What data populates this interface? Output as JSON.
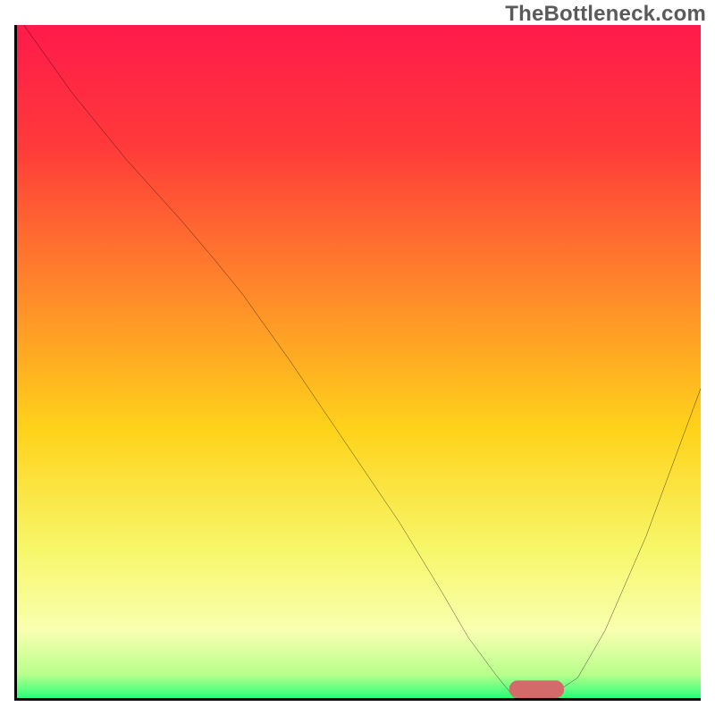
{
  "watermark": "TheBottleneck.com",
  "colors": {
    "axis": "#000000",
    "curve": "#000000",
    "marker": "#d46a6a",
    "gradient_stops": [
      {
        "offset": 0.0,
        "color": "#ff1a4b"
      },
      {
        "offset": 0.18,
        "color": "#ff3a3a"
      },
      {
        "offset": 0.4,
        "color": "#ff8a2a"
      },
      {
        "offset": 0.6,
        "color": "#ffd21a"
      },
      {
        "offset": 0.78,
        "color": "#f7f76a"
      },
      {
        "offset": 0.9,
        "color": "#f9ffb0"
      },
      {
        "offset": 0.965,
        "color": "#b8ff8c"
      },
      {
        "offset": 1.0,
        "color": "#2aff7a"
      }
    ]
  },
  "chart_data": {
    "type": "line",
    "title": "",
    "xlabel": "",
    "ylabel": "",
    "xlim": [
      0,
      100
    ],
    "ylim": [
      0,
      100
    ],
    "grid": false,
    "legend": false,
    "series": [
      {
        "name": "curve",
        "x": [
          1,
          8,
          16,
          24,
          29,
          33,
          40,
          48,
          56,
          62,
          66,
          70,
          72,
          74,
          78,
          82,
          86,
          92,
          100
        ],
        "y": [
          100,
          90,
          80,
          71,
          65,
          60,
          50,
          38,
          26,
          16,
          9,
          3.5,
          1,
          0.3,
          0.3,
          3,
          10,
          24,
          46
        ]
      }
    ],
    "marker": {
      "name": "bottleneck-marker",
      "x_center": 76,
      "y_center": 0,
      "width": 8,
      "height": 2.6,
      "shape": "rounded-rect"
    },
    "background_gradient": {
      "direction": "vertical",
      "stops_ref": "colors.gradient_stops"
    }
  }
}
